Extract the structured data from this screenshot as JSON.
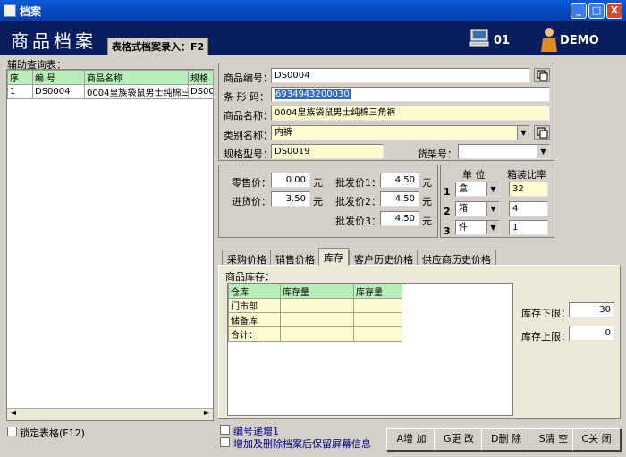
{
  "window": {
    "title": "档案",
    "minimize": "_",
    "maximize": "□",
    "close": "X"
  },
  "header": {
    "title": "商品档案",
    "badge": "表格式档案录入：F2",
    "terminal": "01",
    "user": "DEMO"
  },
  "left": {
    "label": "辅助查询表：",
    "columns": [
      "序",
      "编 号",
      "商品名称",
      "规格"
    ],
    "rows": [
      [
        "1",
        "DS0004",
        "0004皇族袋鼠男士纯棉三",
        "DS00:"
      ]
    ],
    "lock_label": "锁定表格(F12)"
  },
  "form": {
    "code_label": "商品编号：",
    "code": "DS0004",
    "barcode_label": "条 形 码：",
    "barcode": "6934943200030",
    "name_label": "商品名称：",
    "name": "0004皇族袋鼠男士纯棉三角裤",
    "category_label": "类别名称：",
    "category": "内裤",
    "spec_label": "规格型号：",
    "spec": "DS0019",
    "shelf_label": "货架号：",
    "shelf": ""
  },
  "prices": {
    "retail_label": "零售价：",
    "retail": "0.00",
    "purchase_label": "进货价：",
    "purchase": "3.50",
    "w1_label": "批发价1：",
    "w1": "4.50",
    "w2_label": "批发价2：",
    "w2": "4.50",
    "w3_label": "批发价3：",
    "w3": "4.50",
    "unit": "元"
  },
  "units": {
    "unit_header": "单 位",
    "ratio_header": "箱装比率",
    "rows": [
      {
        "idx": "1",
        "unit": "盒",
        "ratio": "32"
      },
      {
        "idx": "2",
        "unit": "箱",
        "ratio": "4"
      },
      {
        "idx": "3",
        "unit": "件",
        "ratio": "1"
      }
    ]
  },
  "tabs": [
    "采购价格",
    "销售价格",
    "库存",
    "客户历史价格",
    "供应商历史价格"
  ],
  "stock": {
    "label": "商品库存：",
    "columns": [
      "仓库",
      "库存量",
      "库存量"
    ],
    "rows": [
      "门市部",
      "储备库",
      "合计："
    ],
    "lower_label": "库存下限：",
    "lower": "30",
    "upper_label": "库存上限：",
    "upper": "0"
  },
  "options": {
    "auto_increment": "编号递增1",
    "keep_info": "增加及删除档案后保留屏幕信息"
  },
  "buttons": {
    "add": "A增 加",
    "edit": "G更 改",
    "delete": "D删 除",
    "clear": "S清 空",
    "close": "C关 闭"
  },
  "colors": {
    "title_bar": "#0a5bd8",
    "header_bg": "#071d5e",
    "highlight": "#316ac5",
    "grid_header": "#b8efb8",
    "yellow_field": "#fffbd0"
  }
}
